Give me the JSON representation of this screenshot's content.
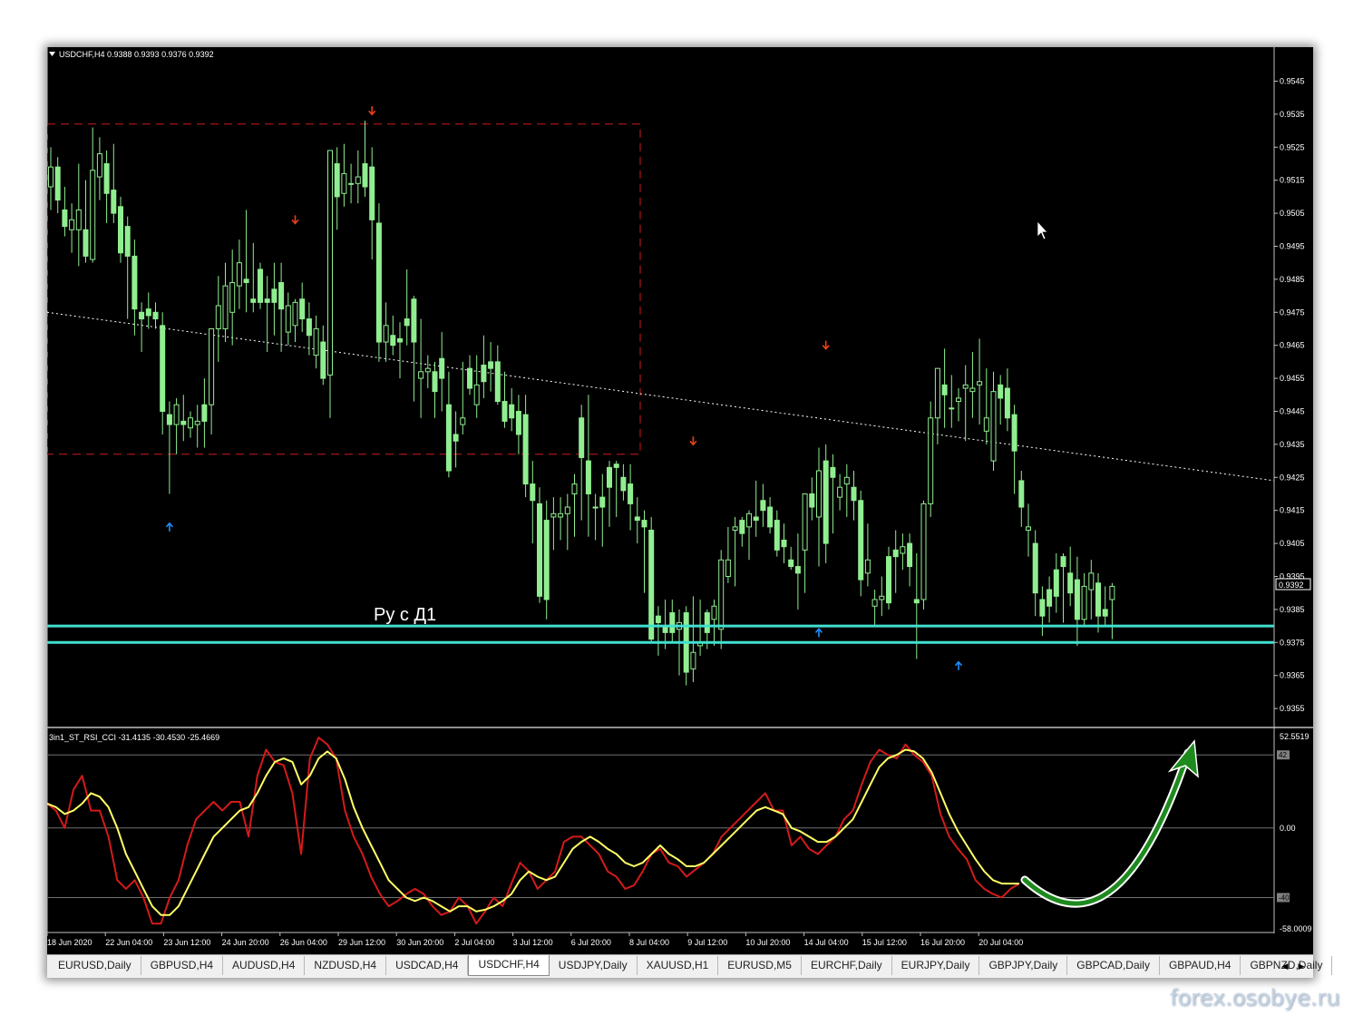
{
  "window": {
    "price_header": "USDCHF,H4  0.9388 0.9393 0.9376 0.9392",
    "indicator_header": "3in1_ST_RSI_CCI -31.4135 -30.4530 -25.4669",
    "annotation_text": "Ру с Д1",
    "current_price": "0.9392"
  },
  "price_axis": {
    "ticks": [
      "0.9545",
      "0.9535",
      "0.9525",
      "0.9515",
      "0.9505",
      "0.9495",
      "0.9485",
      "0.9475",
      "0.9465",
      "0.9455",
      "0.9445",
      "0.9435",
      "0.9425",
      "0.9415",
      "0.9405",
      "0.9395",
      "0.9385",
      "0.9375",
      "0.9365",
      "0.9355"
    ]
  },
  "indicator_axis": {
    "ticks": [
      "52.5519",
      "42",
      "0.00",
      "-40",
      "-58.0009"
    ]
  },
  "time_axis": {
    "labels": [
      "18 Jun 2020",
      "22 Jun 04:00",
      "23 Jun 12:00",
      "24 Jun 20:00",
      "26 Jun 04:00",
      "29 Jun 12:00",
      "30 Jun 20:00",
      "2 Jul 04:00",
      "3 Jul 12:00",
      "6 Jul 20:00",
      "8 Jul 04:00",
      "9 Jul 12:00",
      "10 Jul 20:00",
      "14 Jul 04:00",
      "15 Jul 12:00",
      "16 Jul 20:00",
      "20 Jul 04:00"
    ]
  },
  "tabs": [
    {
      "label": "EURUSD,Daily",
      "active": false
    },
    {
      "label": "GBPUSD,H4",
      "active": false
    },
    {
      "label": "AUDUSD,H4",
      "active": false
    },
    {
      "label": "NZDUSD,H4",
      "active": false
    },
    {
      "label": "USDCAD,H4",
      "active": false
    },
    {
      "label": "USDCHF,H4",
      "active": true
    },
    {
      "label": "USDJPY,Daily",
      "active": false
    },
    {
      "label": "XAUUSD,H1",
      "active": false
    },
    {
      "label": "EURUSD,M5",
      "active": false
    },
    {
      "label": "EURCHF,Daily",
      "active": false
    },
    {
      "label": "EURJPY,Daily",
      "active": false
    },
    {
      "label": "GBPJPY,Daily",
      "active": false
    },
    {
      "label": "GBPCAD,Daily",
      "active": false
    },
    {
      "label": "GBPAUD,H4",
      "active": false
    },
    {
      "label": "GBPNZD,Daily",
      "active": false
    }
  ],
  "watermark": "forex.osobye.ru",
  "colors": {
    "background": "#000000",
    "candle": "#90ee90",
    "support_lines": "#40e0d0",
    "box": "#cc1a1a",
    "arrow_down": "#e8401c",
    "arrow_up": "#1e90ff",
    "indicator_fast": "#d41a1a",
    "indicator_slow": "#ffff66",
    "forecast_arrow": "#1e8a1e"
  },
  "icons": [
    "dropdown-triangle-icon",
    "mouse-cursor-icon",
    "tab-scroll-left-icon",
    "tab-scroll-right-icon"
  ],
  "chart_data": {
    "type": "candlestick",
    "symbol": "USDCHF",
    "timeframe": "H4",
    "ohlc_last": {
      "open": 0.9388,
      "high": 0.9393,
      "low": 0.9376,
      "close": 0.9392
    },
    "ylim": [
      0.9352,
      0.9552
    ],
    "candles": [
      [
        0.9513,
        0.9525,
        0.9506,
        0.9519
      ],
      [
        0.9519,
        0.9522,
        0.9505,
        0.9509
      ],
      [
        0.9506,
        0.9513,
        0.9498,
        0.9501
      ],
      [
        0.95,
        0.9508,
        0.9493,
        0.9503
      ],
      [
        0.95,
        0.952,
        0.9489,
        0.9506
      ],
      [
        0.95,
        0.9515,
        0.949,
        0.9492
      ],
      [
        0.9491,
        0.9531,
        0.949,
        0.9518
      ],
      [
        0.9516,
        0.9528,
        0.9509,
        0.9523
      ],
      [
        0.952,
        0.9524,
        0.9502,
        0.9511
      ],
      [
        0.9512,
        0.9526,
        0.9502,
        0.9505
      ],
      [
        0.9507,
        0.951,
        0.949,
        0.9493
      ],
      [
        0.9501,
        0.9504,
        0.9473,
        0.9492
      ],
      [
        0.9492,
        0.9497,
        0.9468,
        0.9476
      ],
      [
        0.9475,
        0.9478,
        0.9463,
        0.9473
      ],
      [
        0.9476,
        0.9481,
        0.947,
        0.9474
      ],
      [
        0.9475,
        0.9478,
        0.947,
        0.9473
      ],
      [
        0.9471,
        0.9475,
        0.9438,
        0.9445
      ],
      [
        0.9444,
        0.9448,
        0.942,
        0.9441
      ],
      [
        0.9441,
        0.9449,
        0.9432,
        0.9447
      ],
      [
        0.9442,
        0.945,
        0.9436,
        0.9441
      ],
      [
        0.944,
        0.9445,
        0.9437,
        0.9443
      ],
      [
        0.9441,
        0.9447,
        0.9434,
        0.9442
      ],
      [
        0.9447,
        0.9455,
        0.9434,
        0.9442
      ],
      [
        0.9447,
        0.947,
        0.9438,
        0.947
      ],
      [
        0.947,
        0.9486,
        0.946,
        0.9477
      ],
      [
        0.947,
        0.949,
        0.9466,
        0.9483
      ],
      [
        0.9475,
        0.9494,
        0.9465,
        0.9484
      ],
      [
        0.9483,
        0.9497,
        0.9476,
        0.949
      ],
      [
        0.9485,
        0.9506,
        0.9475,
        0.9484
      ],
      [
        0.9479,
        0.9496,
        0.9475,
        0.9478
      ],
      [
        0.9488,
        0.949,
        0.9476,
        0.9478
      ],
      [
        0.9479,
        0.9486,
        0.9463,
        0.9478
      ],
      [
        0.9482,
        0.949,
        0.9468,
        0.9478
      ],
      [
        0.9484,
        0.949,
        0.9463,
        0.9476
      ],
      [
        0.9469,
        0.9481,
        0.9465,
        0.9477
      ],
      [
        0.9471,
        0.9479,
        0.9466,
        0.9478
      ],
      [
        0.9479,
        0.9484,
        0.9469,
        0.9473
      ],
      [
        0.9473,
        0.9478,
        0.9462,
        0.9468
      ],
      [
        0.9462,
        0.9474,
        0.9458,
        0.947
      ],
      [
        0.9466,
        0.9471,
        0.9453,
        0.9455
      ],
      [
        0.9456,
        0.9524,
        0.9443,
        0.9524
      ],
      [
        0.952,
        0.9525,
        0.95,
        0.951
      ],
      [
        0.9511,
        0.9526,
        0.9507,
        0.9517
      ],
      [
        0.9514,
        0.952,
        0.9508,
        0.9514
      ],
      [
        0.9514,
        0.9524,
        0.9508,
        0.9516
      ],
      [
        0.952,
        0.9533,
        0.951,
        0.9513
      ],
      [
        0.9519,
        0.9525,
        0.9491,
        0.9503
      ],
      [
        0.9502,
        0.9508,
        0.946,
        0.9466
      ],
      [
        0.9466,
        0.9478,
        0.946,
        0.9471
      ],
      [
        0.9468,
        0.9474,
        0.9462,
        0.9465
      ],
      [
        0.9467,
        0.9472,
        0.9455,
        0.9466
      ],
      [
        0.9473,
        0.9488,
        0.9465,
        0.9471
      ],
      [
        0.9479,
        0.948,
        0.9448,
        0.9466
      ],
      [
        0.9455,
        0.9473,
        0.9443,
        0.9457
      ],
      [
        0.9457,
        0.9462,
        0.9452,
        0.9458
      ],
      [
        0.9457,
        0.946,
        0.9443,
        0.9451
      ],
      [
        0.9461,
        0.9469,
        0.9445,
        0.9455
      ],
      [
        0.9447,
        0.9457,
        0.9425,
        0.9427
      ],
      [
        0.9438,
        0.9445,
        0.9428,
        0.9436
      ],
      [
        0.9441,
        0.946,
        0.9438,
        0.9443
      ],
      [
        0.9458,
        0.9462,
        0.945,
        0.9452
      ],
      [
        0.9447,
        0.9462,
        0.9443,
        0.9453
      ],
      [
        0.9459,
        0.9468,
        0.9449,
        0.9454
      ],
      [
        0.946,
        0.9466,
        0.9451,
        0.9458
      ],
      [
        0.946,
        0.9465,
        0.9447,
        0.9448
      ],
      [
        0.9448,
        0.9457,
        0.944,
        0.9442
      ],
      [
        0.9447,
        0.9452,
        0.9439,
        0.9443
      ],
      [
        0.9445,
        0.945,
        0.9432,
        0.9438
      ],
      [
        0.9444,
        0.945,
        0.9419,
        0.9423
      ],
      [
        0.9423,
        0.943,
        0.9405,
        0.9418
      ],
      [
        0.9417,
        0.9422,
        0.9387,
        0.9389
      ],
      [
        0.9412,
        0.9418,
        0.9382,
        0.9388
      ],
      [
        0.9413,
        0.9419,
        0.9403,
        0.9414
      ],
      [
        0.9413,
        0.9419,
        0.9406,
        0.9414
      ],
      [
        0.9414,
        0.942,
        0.9403,
        0.9416
      ],
      [
        0.942,
        0.9426,
        0.9407,
        0.9423
      ],
      [
        0.9443,
        0.9447,
        0.9412,
        0.9431
      ],
      [
        0.943,
        0.945,
        0.9407,
        0.942
      ],
      [
        0.9416,
        0.942,
        0.9406,
        0.9416
      ],
      [
        0.9419,
        0.9426,
        0.9404,
        0.9416
      ],
      [
        0.9428,
        0.943,
        0.941,
        0.9422
      ],
      [
        0.9429,
        0.943,
        0.9413,
        0.9428
      ],
      [
        0.9425,
        0.9429,
        0.9418,
        0.9421
      ],
      [
        0.9423,
        0.9429,
        0.9409,
        0.9417
      ],
      [
        0.9413,
        0.9419,
        0.9405,
        0.9412
      ],
      [
        0.9412,
        0.9415,
        0.939,
        0.941
      ],
      [
        0.9409,
        0.9413,
        0.9375,
        0.9376
      ],
      [
        0.9383,
        0.9386,
        0.9371,
        0.9381
      ],
      [
        0.938,
        0.9388,
        0.9373,
        0.9378
      ],
      [
        0.9384,
        0.9388,
        0.9375,
        0.9378
      ],
      [
        0.9379,
        0.9385,
        0.9365,
        0.9381
      ],
      [
        0.9384,
        0.9386,
        0.9362,
        0.9366
      ],
      [
        0.9367,
        0.9389,
        0.9363,
        0.9372
      ],
      [
        0.9374,
        0.9388,
        0.9371,
        0.9375
      ],
      [
        0.9384,
        0.9385,
        0.9373,
        0.9378
      ],
      [
        0.9382,
        0.9388,
        0.9374,
        0.9386
      ],
      [
        0.9379,
        0.9403,
        0.9373,
        0.94
      ],
      [
        0.9395,
        0.941,
        0.9393,
        0.94
      ],
      [
        0.9409,
        0.9413,
        0.9392,
        0.941
      ],
      [
        0.9412,
        0.9413,
        0.9404,
        0.9408
      ],
      [
        0.941,
        0.9415,
        0.94,
        0.9414
      ],
      [
        0.9413,
        0.9424,
        0.9407,
        0.9412
      ],
      [
        0.9418,
        0.9423,
        0.941,
        0.9415
      ],
      [
        0.9416,
        0.9419,
        0.9408,
        0.941
      ],
      [
        0.9412,
        0.9415,
        0.9401,
        0.9403
      ],
      [
        0.9406,
        0.9411,
        0.9399,
        0.9404
      ],
      [
        0.94,
        0.9404,
        0.9397,
        0.9398
      ],
      [
        0.9398,
        0.9408,
        0.9385,
        0.9396
      ],
      [
        0.9403,
        0.942,
        0.939,
        0.942
      ],
      [
        0.942,
        0.9425,
        0.9412,
        0.9416
      ],
      [
        0.9413,
        0.9434,
        0.9398,
        0.9427
      ],
      [
        0.943,
        0.9435,
        0.9399,
        0.9405
      ],
      [
        0.9428,
        0.9432,
        0.9408,
        0.9425
      ],
      [
        0.9419,
        0.9426,
        0.9415,
        0.9422
      ],
      [
        0.9423,
        0.9429,
        0.9413,
        0.9425
      ],
      [
        0.9422,
        0.9427,
        0.9412,
        0.9418
      ],
      [
        0.9418,
        0.9421,
        0.9389,
        0.9394
      ],
      [
        0.9396,
        0.9411,
        0.9392,
        0.94
      ],
      [
        0.9386,
        0.9391,
        0.938,
        0.9388
      ],
      [
        0.9388,
        0.9395,
        0.9383,
        0.9389
      ],
      [
        0.9401,
        0.9404,
        0.9385,
        0.9387
      ],
      [
        0.9403,
        0.9409,
        0.939,
        0.9401
      ],
      [
        0.9402,
        0.9408,
        0.9397,
        0.9404
      ],
      [
        0.9405,
        0.9408,
        0.9392,
        0.9398
      ],
      [
        0.9388,
        0.9402,
        0.937,
        0.9387
      ],
      [
        0.9388,
        0.9418,
        0.9385,
        0.9417
      ],
      [
        0.9417,
        0.9448,
        0.9413,
        0.9443
      ],
      [
        0.9443,
        0.9458,
        0.9435,
        0.9458
      ],
      [
        0.9453,
        0.9464,
        0.944,
        0.945
      ],
      [
        0.9446,
        0.9456,
        0.944,
        0.9446
      ],
      [
        0.9448,
        0.9452,
        0.9442,
        0.9449
      ],
      [
        0.9452,
        0.9459,
        0.9436,
        0.9453
      ],
      [
        0.9451,
        0.9463,
        0.9443,
        0.9452
      ],
      [
        0.9453,
        0.9467,
        0.9441,
        0.9454
      ],
      [
        0.9439,
        0.9458,
        0.9435,
        0.9443
      ],
      [
        0.943,
        0.9457,
        0.9427,
        0.9451
      ],
      [
        0.9453,
        0.9456,
        0.9441,
        0.9449
      ],
      [
        0.9452,
        0.9458,
        0.9439,
        0.9443
      ],
      [
        0.9444,
        0.9447,
        0.942,
        0.9433
      ],
      [
        0.9424,
        0.9427,
        0.941,
        0.9416
      ],
      [
        0.9409,
        0.9417,
        0.9401,
        0.941
      ],
      [
        0.9405,
        0.9409,
        0.9383,
        0.939
      ],
      [
        0.9388,
        0.9392,
        0.9377,
        0.9383
      ],
      [
        0.9391,
        0.9395,
        0.9381,
        0.9386
      ],
      [
        0.9397,
        0.9402,
        0.9384,
        0.9389
      ],
      [
        0.9401,
        0.9402,
        0.9381,
        0.9398
      ],
      [
        0.9396,
        0.9404,
        0.9386,
        0.939
      ],
      [
        0.9394,
        0.9401,
        0.9374,
        0.9382
      ],
      [
        0.9382,
        0.9396,
        0.938,
        0.9392
      ],
      [
        0.9391,
        0.94,
        0.9382,
        0.9396
      ],
      [
        0.9393,
        0.9396,
        0.9378,
        0.9383
      ],
      [
        0.9385,
        0.9392,
        0.938,
        0.9383
      ],
      [
        0.9388,
        0.9393,
        0.9376,
        0.9392
      ]
    ],
    "support_levels": [
      0.938,
      0.9375
    ],
    "range_box": {
      "high": 0.9532,
      "low": 0.9432
    },
    "trendline": {
      "from": 0.9475,
      "to": 0.9424
    },
    "arrows_down": [
      {
        "bar": 46,
        "price": 0.9536
      },
      {
        "bar": 35,
        "price": 0.9503
      },
      {
        "bar": 92,
        "price": 0.9436
      },
      {
        "bar": 111,
        "price": 0.9465
      }
    ],
    "arrows_up": [
      {
        "bar": 17,
        "price": 0.941
      },
      {
        "bar": 110,
        "price": 0.9378
      },
      {
        "bar": 130,
        "price": 0.9368
      }
    ],
    "indicator": {
      "ylim": [
        -58.0009,
        52.5519
      ],
      "levels": [
        42,
        0,
        -40
      ],
      "fast": [
        14,
        10,
        0,
        22,
        30,
        10,
        10,
        -5,
        -30,
        -35,
        -30,
        -40,
        -55,
        -55,
        -40,
        -30,
        -10,
        5,
        10,
        15,
        10,
        15,
        15,
        -5,
        30,
        45,
        38,
        36,
        20,
        -15,
        40,
        52,
        48,
        40,
        10,
        -5,
        -15,
        -28,
        -38,
        -45,
        -42,
        -38,
        -35,
        -38,
        -45,
        -50,
        -48,
        -40,
        -45,
        -55,
        -48,
        -40,
        -45,
        -32,
        -20,
        -25,
        -35,
        -30,
        -25,
        -8,
        -5,
        -5,
        -10,
        -15,
        -25,
        -28,
        -35,
        -33,
        -25,
        -15,
        -12,
        -20,
        -22,
        -28,
        -24,
        -20,
        -15,
        -5,
        0,
        5,
        10,
        15,
        20,
        10,
        10,
        -10,
        -5,
        -12,
        -15,
        -10,
        -5,
        5,
        10,
        25,
        38,
        45,
        42,
        40,
        48,
        42,
        38,
        30,
        8,
        -5,
        -12,
        -18,
        -30,
        -35,
        -38,
        -40,
        -35,
        -32
      ],
      "slow": [
        14,
        12,
        8,
        10,
        14,
        20,
        18,
        12,
        0,
        -15,
        -25,
        -35,
        -45,
        -50,
        -50,
        -45,
        -35,
        -25,
        -15,
        -5,
        0,
        5,
        10,
        12,
        20,
        30,
        38,
        40,
        38,
        25,
        30,
        40,
        44,
        40,
        28,
        12,
        0,
        -10,
        -20,
        -30,
        -35,
        -40,
        -42,
        -40,
        -42,
        -45,
        -48,
        -45,
        -45,
        -48,
        -47,
        -45,
        -42,
        -38,
        -30,
        -25,
        -28,
        -30,
        -28,
        -20,
        -12,
        -8,
        -5,
        -8,
        -12,
        -15,
        -20,
        -22,
        -20,
        -15,
        -10,
        -15,
        -18,
        -22,
        -22,
        -20,
        -15,
        -10,
        -5,
        0,
        5,
        10,
        12,
        10,
        8,
        0,
        -2,
        -5,
        -8,
        -8,
        -5,
        0,
        5,
        15,
        25,
        35,
        40,
        42,
        45,
        44,
        40,
        32,
        20,
        8,
        -2,
        -10,
        -18,
        -25,
        -30,
        -32,
        -32,
        -32
      ]
    },
    "forecast": "curved green arrow pointing up"
  }
}
